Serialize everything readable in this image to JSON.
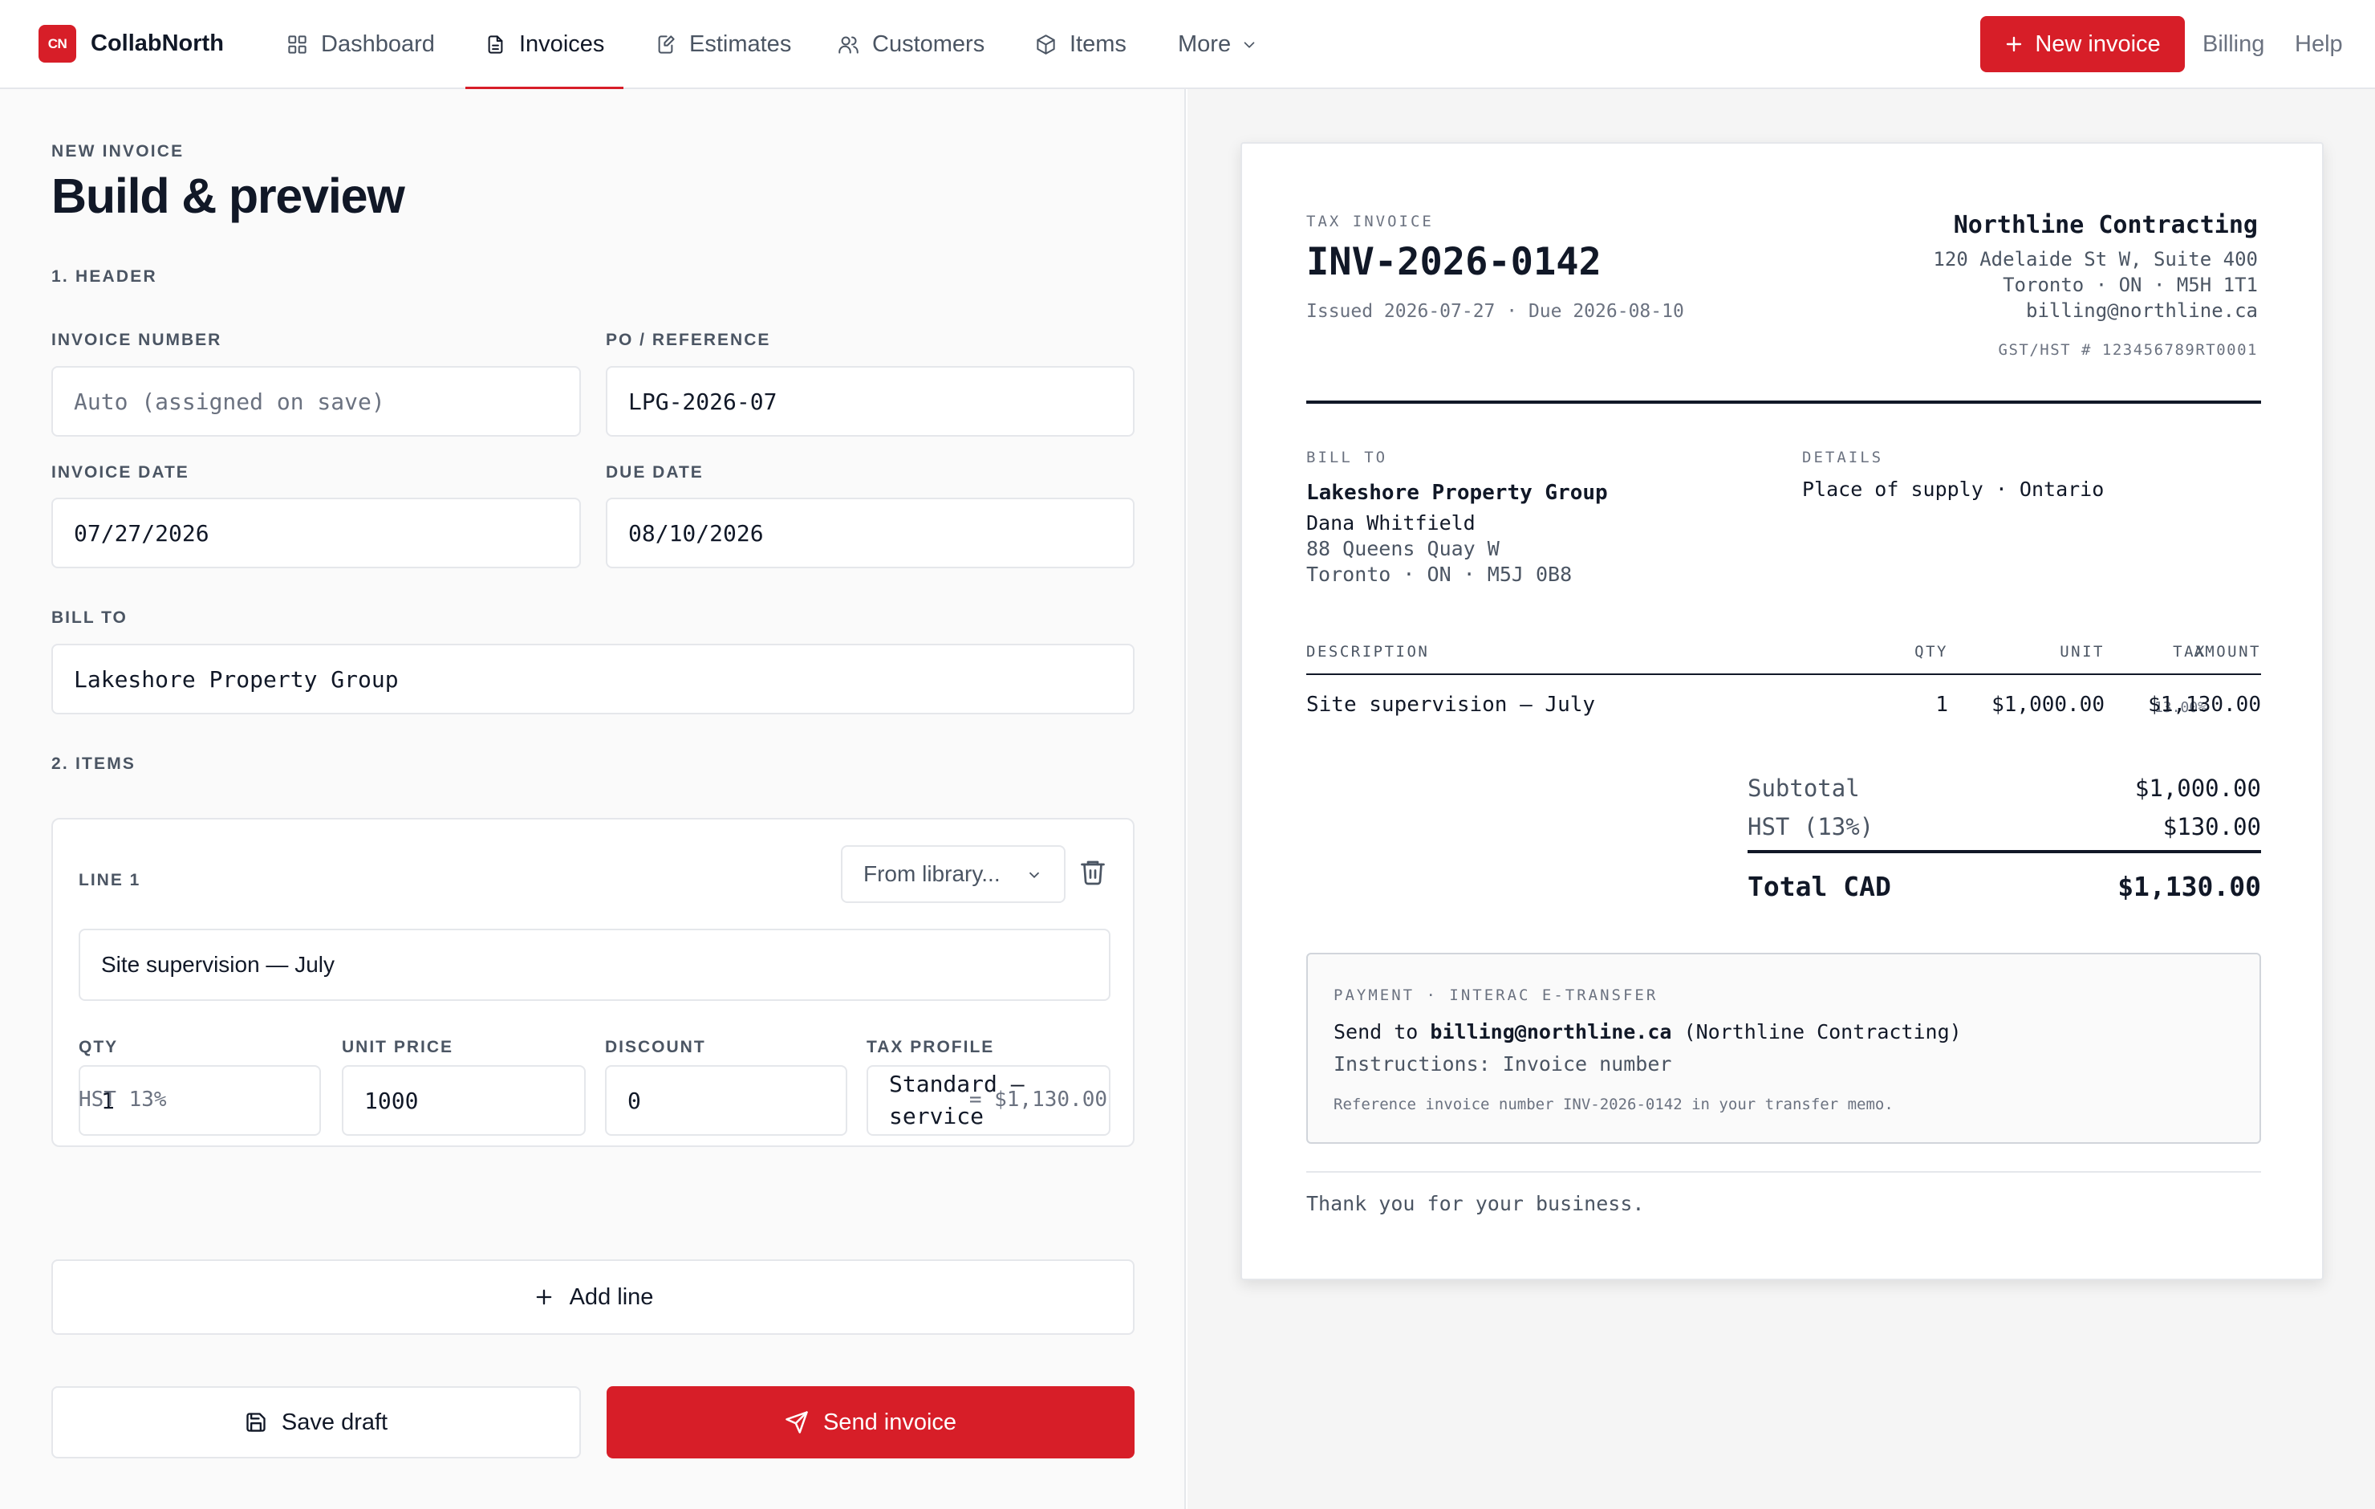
{
  "app": {
    "logo_text": "CN",
    "name": "CollabNorth"
  },
  "nav": {
    "dashboard": "Dashboard",
    "invoices": "Invoices",
    "estimates": "Estimates",
    "customers": "Customers",
    "items": "Items",
    "more": "More"
  },
  "header_actions": {
    "new_invoice": "New invoice",
    "billing": "Billing",
    "help": "Help"
  },
  "editor": {
    "eyebrow": "NEW INVOICE",
    "title": "Build & preview",
    "section_header": "1. HEADER",
    "section_items": "2. ITEMS",
    "invoice_number": {
      "label": "INVOICE NUMBER",
      "placeholder": "Auto (assigned on save)"
    },
    "po_reference": {
      "label": "PO / REFERENCE",
      "value": "LPG-2026-07"
    },
    "invoice_date": {
      "label": "INVOICE DATE",
      "value": "07/27/2026"
    },
    "due_date": {
      "label": "DUE DATE",
      "value": "08/10/2026"
    },
    "bill_to": {
      "label": "BILL TO",
      "value": "Lakeshore Property Group"
    },
    "line": {
      "label": "LINE 1",
      "library": "From library...",
      "description": "Site supervision — July",
      "qty_label": "QTY",
      "qty": "1",
      "unit_price_label": "UNIT PRICE",
      "unit_price": "1000",
      "discount_label": "DISCOUNT",
      "discount": "0",
      "tax_profile_label": "TAX PROFILE",
      "tax_profile_1": "Standard —",
      "tax_profile_2": "service",
      "tax_note": "HST 13%",
      "line_total": "= $1,130.00"
    },
    "add_line": "Add line",
    "save_draft": "Save draft",
    "send_invoice": "Send invoice"
  },
  "preview": {
    "doc_type": "TAX INVOICE",
    "invoice_no": "INV-2026-0142",
    "issued_due": "Issued 2026-07-27 · Due 2026-08-10",
    "business": {
      "name": "Northline Contracting",
      "addr1": "120 Adelaide St W, Suite 400",
      "addr2": "Toronto · ON · M5H 1T1",
      "email": "billing@northline.ca",
      "gst": "GST/HST # 123456789RT0001"
    },
    "bill_to_label": "BILL TO",
    "bill_to": {
      "company": "Lakeshore Property Group",
      "contact": "Dana Whitfield",
      "addr1": "88 Queens Quay W",
      "addr2": "Toronto · ON · M5J 0B8"
    },
    "details_label": "DETAILS",
    "details": "Place of supply · Ontario",
    "table": {
      "headers": {
        "description": "DESCRIPTION",
        "qty": "QTY",
        "unit": "UNIT",
        "tax": "TAX",
        "amount": "AMOUNT"
      },
      "rows": [
        {
          "description": "Site supervision — July",
          "qty": "1",
          "unit": "$1,000.00",
          "tax": "13.00%",
          "amount": "$1,130.00"
        }
      ]
    },
    "subtotal_label": "Subtotal",
    "subtotal": "$1,000.00",
    "hst_label": "HST (13%)",
    "hst": "$130.00",
    "total_label": "Total CAD",
    "total": "$1,130.00",
    "payment": {
      "label": "PAYMENT · INTERAC E-TRANSFER",
      "send_to_prefix": "Send to",
      "email": "billing@northline.ca",
      "send_to_suffix": "(Northline Contracting)",
      "instructions": "Instructions: Invoice number",
      "reference_note": "Reference invoice number INV-2026-0142 in your transfer memo."
    },
    "thanks": "Thank you for your business."
  },
  "colors": {
    "accent": "#d71e28",
    "border": "#e5e7eb",
    "text": "#111827",
    "muted": "#6b7280"
  }
}
